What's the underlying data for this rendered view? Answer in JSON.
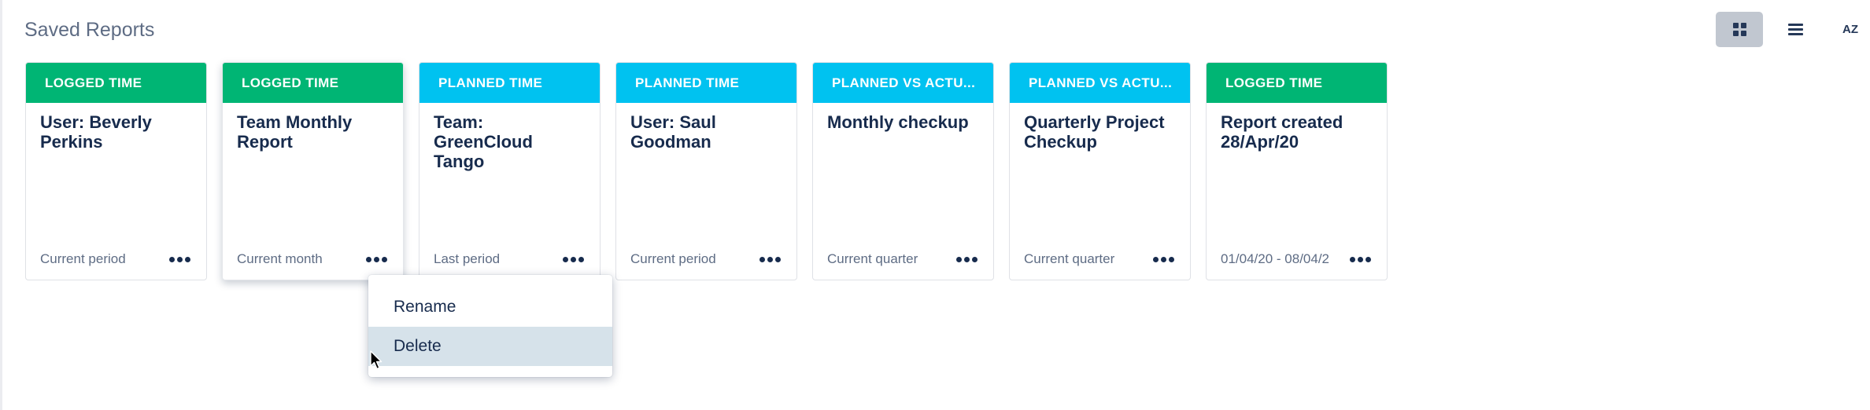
{
  "header": {
    "title": "Saved Reports"
  },
  "toolbar": {
    "grid_icon": "grid-view-icon",
    "list_icon": "list-view-icon",
    "sort_icon": "sort-az-icon",
    "sort_label": "AZ",
    "active": "grid"
  },
  "colors": {
    "logged": "#00b574",
    "planned": "#00c2f0",
    "header_text": "#ffffff",
    "menu_hover": "#d6e2ea"
  },
  "reports": [
    {
      "type": "LOGGED TIME",
      "title": "User: Beverly Perkins",
      "period": "Current period"
    },
    {
      "type": "LOGGED TIME",
      "title": "Team Monthly Report",
      "period": "Current month"
    },
    {
      "type": "PLANNED TIME",
      "title": "Team: GreenCloud Tango",
      "period": "Last period"
    },
    {
      "type": "PLANNED TIME",
      "title": "User: Saul Goodman",
      "period": "Current period"
    },
    {
      "type": "PLANNED VS ACTU...",
      "title": "Monthly checkup",
      "period": "Current quarter"
    },
    {
      "type": "PLANNED VS ACTU...",
      "title": "Quarterly Project Checkup",
      "period": "Current quarter"
    },
    {
      "type": "LOGGED TIME",
      "title": "Report created 28/Apr/20",
      "period": "01/04/20 - 08/04/2"
    }
  ],
  "context_menu": {
    "items": [
      {
        "label": "Rename"
      },
      {
        "label": "Delete"
      }
    ]
  }
}
